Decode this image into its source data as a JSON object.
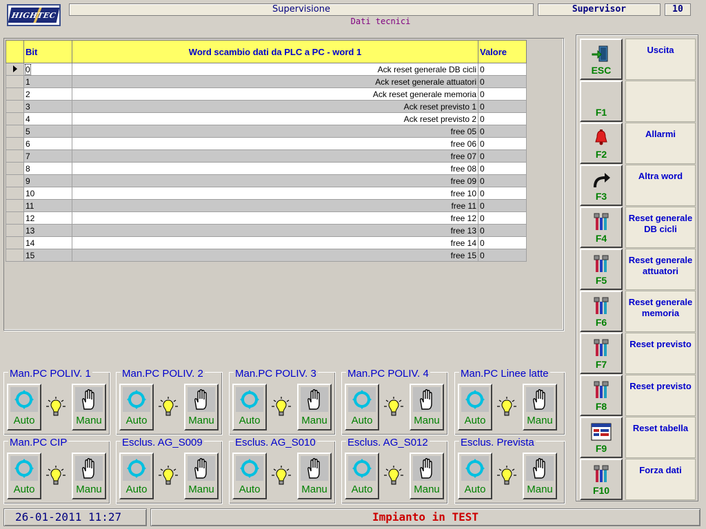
{
  "header": {
    "title": "Supervisione",
    "subtitle": "Dati tecnici",
    "user": "Supervisor",
    "level": "10"
  },
  "grid": {
    "columns": [
      "Bit",
      "Word scambio dati da PLC a PC - word 1",
      "Valore"
    ],
    "rows": [
      {
        "bit": "0",
        "desc": "Ack reset generale DB cicli",
        "value": "0"
      },
      {
        "bit": "1",
        "desc": "Ack reset generale attuatori",
        "value": "0"
      },
      {
        "bit": "2",
        "desc": "Ack reset generale memoria",
        "value": "0"
      },
      {
        "bit": "3",
        "desc": "Ack reset previsto 1",
        "value": "0"
      },
      {
        "bit": "4",
        "desc": "Ack reset previsto 2",
        "value": "0"
      },
      {
        "bit": "5",
        "desc": "free 05",
        "value": "0"
      },
      {
        "bit": "6",
        "desc": "free 06",
        "value": "0"
      },
      {
        "bit": "7",
        "desc": "free 07",
        "value": "0"
      },
      {
        "bit": "8",
        "desc": "free 08",
        "value": "0"
      },
      {
        "bit": "9",
        "desc": "free 09",
        "value": "0"
      },
      {
        "bit": "10",
        "desc": "free 10",
        "value": "0"
      },
      {
        "bit": "11",
        "desc": "free 11",
        "value": "0"
      },
      {
        "bit": "12",
        "desc": "free 12",
        "value": "0"
      },
      {
        "bit": "13",
        "desc": "free 13",
        "value": "0"
      },
      {
        "bit": "14",
        "desc": "free 14",
        "value": "0"
      },
      {
        "bit": "15",
        "desc": "free 15",
        "value": "0"
      }
    ]
  },
  "fkeys": [
    {
      "key": "ESC",
      "desc": "Uscita",
      "icon": "exit-door-icon"
    },
    {
      "key": "F1",
      "desc": "",
      "icon": ""
    },
    {
      "key": "F2",
      "desc": "Allarmi",
      "icon": "alarm-bell-icon"
    },
    {
      "key": "F3",
      "desc": "Altra word",
      "icon": "curved-arrow-icon"
    },
    {
      "key": "F4",
      "desc": "Reset generale DB cicli",
      "icon": "tools-icon"
    },
    {
      "key": "F5",
      "desc": "Reset generale attuatori",
      "icon": "tools-icon"
    },
    {
      "key": "F6",
      "desc": "Reset generale memoria",
      "icon": "tools-icon"
    },
    {
      "key": "F7",
      "desc": "Reset previsto",
      "icon": "tools-icon"
    },
    {
      "key": "F8",
      "desc": "Reset previsto",
      "icon": "tools-icon"
    },
    {
      "key": "F9",
      "desc": "Reset tabella",
      "icon": "table-icon"
    },
    {
      "key": "F10",
      "desc": "Forza dati",
      "icon": "tools-icon"
    }
  ],
  "modes": [
    {
      "title": "Man.PC POLIV. 1",
      "auto": "Auto",
      "manu": "Manu"
    },
    {
      "title": "Man.PC POLIV. 2",
      "auto": "Auto",
      "manu": "Manu"
    },
    {
      "title": "Man.PC POLIV. 3",
      "auto": "Auto",
      "manu": "Manu"
    },
    {
      "title": "Man.PC POLIV. 4",
      "auto": "Auto",
      "manu": "Manu"
    },
    {
      "title": "Man.PC Linee latte",
      "auto": "Auto",
      "manu": "Manu"
    },
    {
      "title": "Man.PC CIP",
      "auto": "Auto",
      "manu": "Manu"
    },
    {
      "title": "Esclus. AG_S009",
      "auto": "Auto",
      "manu": "Manu"
    },
    {
      "title": "Esclus. AG_S010",
      "auto": "Auto",
      "manu": "Manu"
    },
    {
      "title": "Esclus. AG_S012",
      "auto": "Auto",
      "manu": "Manu"
    },
    {
      "title": "Esclus. Prevista",
      "auto": "Auto",
      "manu": "Manu"
    }
  ],
  "status": {
    "datetime": "26-01-2011 11:27",
    "message": "Impianto in TEST"
  }
}
